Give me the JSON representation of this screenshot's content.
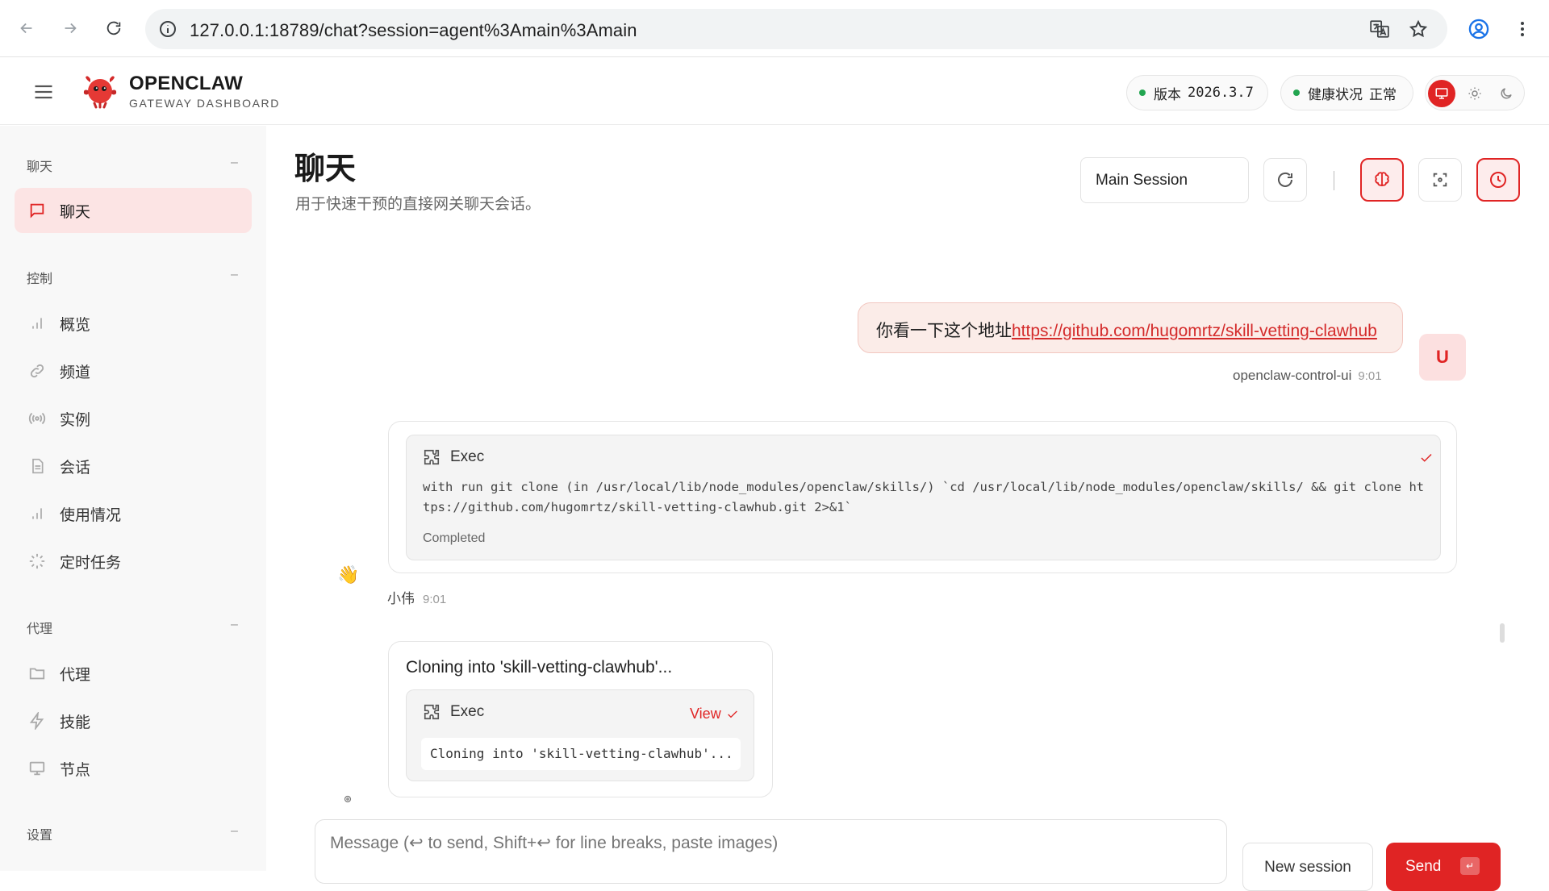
{
  "browser": {
    "url": "127.0.0.1:18789/chat?session=agent%3Amain%3Amain"
  },
  "header": {
    "brand": "OPENCLAW",
    "brand_sub": "GATEWAY DASHBOARD",
    "version_label": "版本",
    "version_value": "2026.3.7",
    "health_label": "健康状况",
    "health_value": "正常"
  },
  "sidebar": {
    "sections": [
      {
        "title": "聊天",
        "toggle": "–",
        "items": [
          {
            "label": "聊天",
            "icon": "chat-icon",
            "active": true
          }
        ]
      },
      {
        "title": "控制",
        "toggle": "–",
        "items": [
          {
            "label": "概览",
            "icon": "bar-chart-icon"
          },
          {
            "label": "频道",
            "icon": "link-icon"
          },
          {
            "label": "实例",
            "icon": "broadcast-icon"
          },
          {
            "label": "会话",
            "icon": "document-icon"
          },
          {
            "label": "使用情况",
            "icon": "bar-chart-icon"
          },
          {
            "label": "定时任务",
            "icon": "loader-icon"
          }
        ]
      },
      {
        "title": "代理",
        "toggle": "–",
        "items": [
          {
            "label": "代理",
            "icon": "folder-icon"
          },
          {
            "label": "技能",
            "icon": "bolt-icon"
          },
          {
            "label": "节点",
            "icon": "monitor-icon"
          }
        ]
      },
      {
        "title": "设置",
        "toggle": "–",
        "items": []
      }
    ]
  },
  "main": {
    "title": "聊天",
    "subtitle": "用于快速干预的直接网关聊天会话。",
    "session_select": "Main Session"
  },
  "chat": {
    "user_message_prefix": "你看一下这个地址",
    "user_message_link": "https://github.com/hugomrtz/skill-vetting-clawhub",
    "user_sender": "openclaw-control-ui",
    "user_time": "9:01",
    "user_avatar": "U",
    "tool1": {
      "name": "Exec",
      "command": "with run git clone (in /usr/local/lib/node_modules/openclaw/skills/) `cd /usr/local/lib/node_modules/openclaw/skills/ && git clone https://github.com/hugomrtz/skill-vetting-clawhub.git 2>&1`",
      "status": "Completed"
    },
    "bot_sender": "小伟",
    "bot_time": "9:01",
    "bot_avatar": "👋",
    "message2_text": "Cloning into 'skill-vetting-clawhub'...",
    "tool2": {
      "name": "Exec",
      "view_label": "View",
      "output": "Cloning into 'skill-vetting-clawhub'..."
    }
  },
  "composer": {
    "placeholder": "Message (↩ to send, Shift+↩ for line breaks, paste images)",
    "new_session": "New session",
    "send": "Send",
    "send_kbd": "↵"
  },
  "colors": {
    "accent": "#e02424",
    "ok": "#22a550"
  }
}
